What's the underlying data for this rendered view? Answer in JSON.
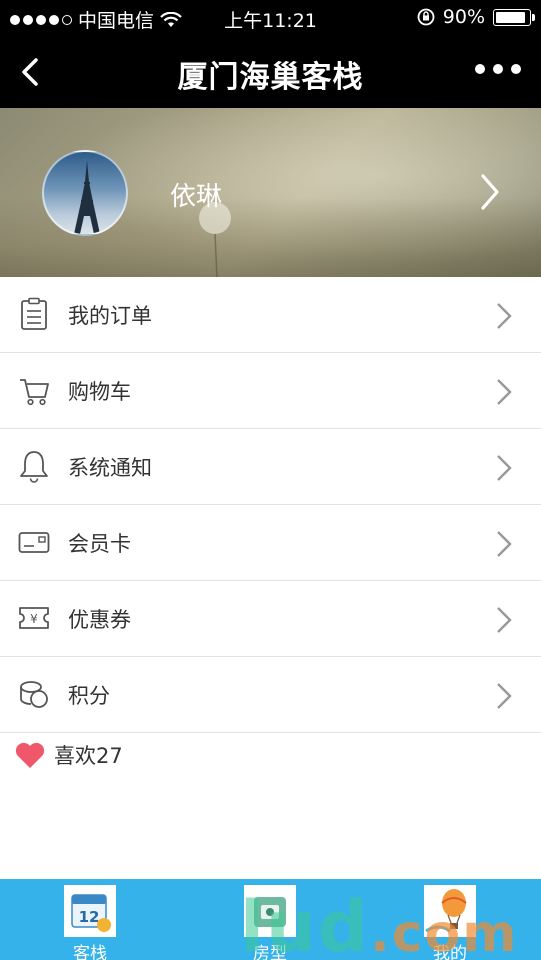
{
  "status_bar": {
    "carrier": "中国电信",
    "time": "上午11:21",
    "battery": "90%",
    "battery_level": 0.9
  },
  "nav": {
    "title": "厦门海巢客栈",
    "back_icon": "chevron-left-icon",
    "more_icon": "more-dots-icon"
  },
  "profile": {
    "name": "依琳"
  },
  "menu": [
    {
      "label": "我的订单",
      "icon": "order-list-icon"
    },
    {
      "label": "购物车",
      "icon": "cart-icon"
    },
    {
      "label": "系统通知",
      "icon": "bell-icon"
    },
    {
      "label": "会员卡",
      "icon": "card-icon"
    },
    {
      "label": "优惠券",
      "icon": "coupon-icon"
    },
    {
      "label": "积分",
      "icon": "coins-icon"
    }
  ],
  "likes": {
    "text": "喜欢27",
    "icon": "heart-icon"
  },
  "tabs": [
    {
      "label": "客栈",
      "icon": "calendar-icon"
    },
    {
      "label": "房型",
      "icon": "room-icon"
    },
    {
      "label": "我的",
      "icon": "balloon-icon"
    }
  ],
  "watermark": {
    "main": "lud",
    "suffix": ".com"
  },
  "colors": {
    "tab_bar": "#35b2ea",
    "heart": "#f0576a",
    "nav_bg": "#000000"
  }
}
